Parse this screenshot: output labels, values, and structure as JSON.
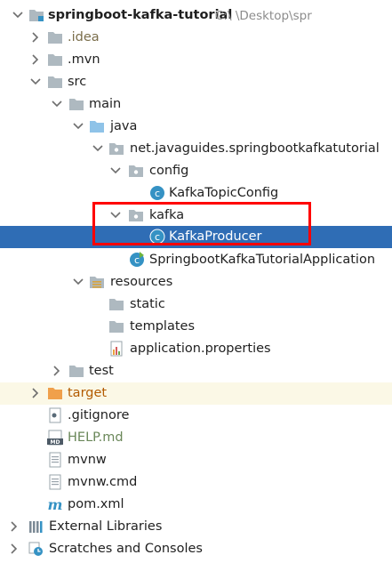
{
  "project": {
    "name": "springboot-kafka-tutorial",
    "path": "C:\\        \\Desktop\\spr"
  },
  "tree": {
    "idea": ".idea",
    "mvn": ".mvn",
    "src": "src",
    "main": "main",
    "java": "java",
    "package": "net.javaguides.springbootkafkatutorial",
    "config": "config",
    "kafka_topic_config": "KafkaTopicConfig",
    "kafka": "kafka",
    "kafka_producer": "KafkaProducer",
    "application_class": "SpringbootKafkaTutorialApplication",
    "resources": "resources",
    "static": "static",
    "templates": "templates",
    "application_properties": "application.properties",
    "test": "test",
    "target": "target",
    "gitignore": ".gitignore",
    "help_md": "HELP.md",
    "mvnw": "mvnw",
    "mvnw_cmd": "mvnw.cmd",
    "pom": "pom.xml",
    "external_libraries": "External Libraries",
    "scratches": "Scratches and Consoles"
  },
  "icons": {
    "folder": "folder-icon",
    "package": "package-icon",
    "class": "java-class-icon",
    "spring_app": "spring-boot-class-icon",
    "properties": "properties-file-icon",
    "text_file": "text-file-icon",
    "markdown": "markdown-file-icon",
    "maven": "maven-icon",
    "libraries": "libraries-icon",
    "scratches": "scratches-icon"
  },
  "colors": {
    "selection": "#2f6db5",
    "highlight_box": "#ff0000",
    "folder": "#aeb9c0",
    "target_folder": "#f0a04b",
    "class_icon": "#3592c4"
  }
}
